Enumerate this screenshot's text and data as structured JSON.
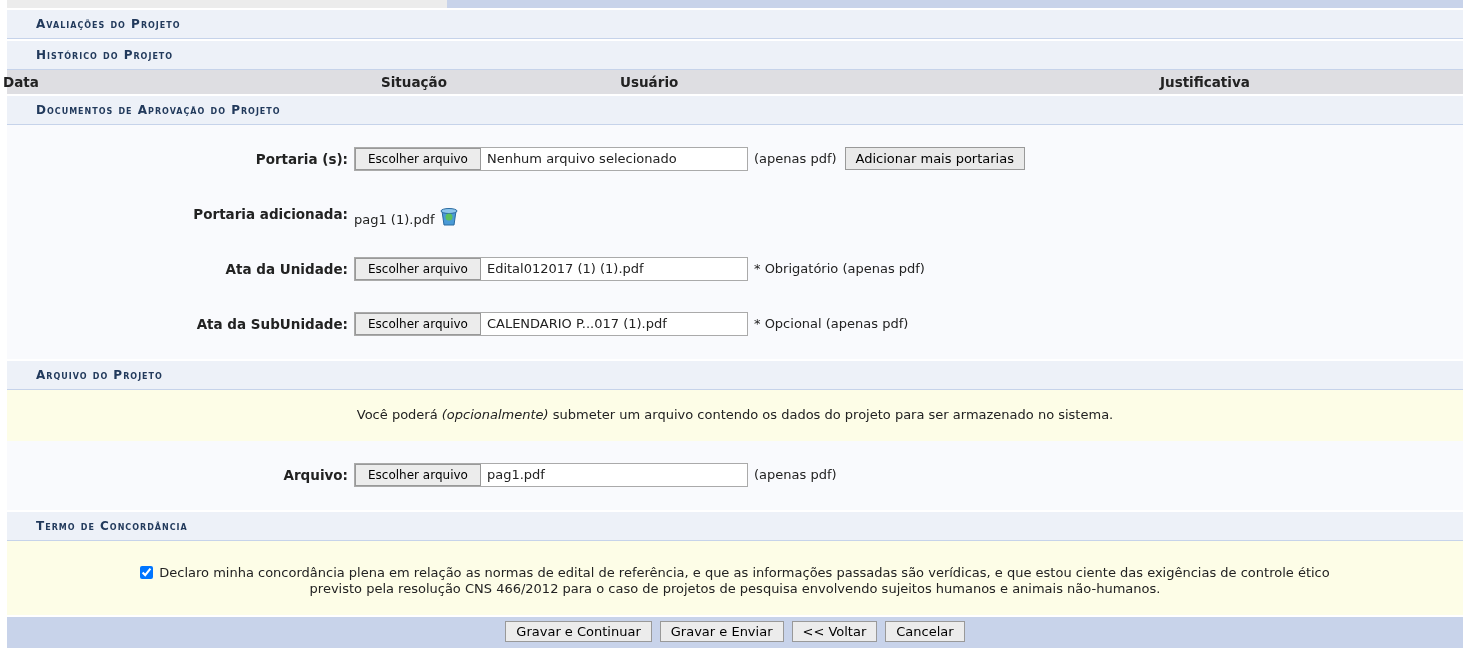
{
  "sections": [
    {
      "title": "Avaliações do Projeto"
    },
    {
      "title": "Histórico do Projeto",
      "columns": [
        "Data",
        "Situação",
        "Usuário",
        "Justificativa"
      ]
    },
    {
      "title": "Documentos de Aprovação do Projeto",
      "fields": [
        {
          "kind": "file",
          "label": "Portaria (s):",
          "button": "Escolher arquivo",
          "value": "Nenhum arquivo selecionado",
          "note": "(apenas pdf)",
          "action": "Adicionar mais portarias"
        },
        {
          "kind": "attached",
          "label": "Portaria adicionada:",
          "value": "pag1 (1).pdf"
        },
        {
          "kind": "file",
          "label": "Ata da Unidade:",
          "button": "Escolher arquivo",
          "value": "Edital012017 (1) (1).pdf",
          "note": "* Obrigatório (apenas pdf)"
        },
        {
          "kind": "file",
          "label": "Ata da SubUnidade:",
          "button": "Escolher arquivo",
          "value": "CALENDARIO P...017 (1).pdf",
          "note": "* Opcional (apenas pdf)"
        }
      ]
    },
    {
      "title": "Arquivo do Projeto",
      "notice": "Você poderá *(opcionalmente)* submeter um arquivo contendo os dados do projeto para ser armazenado no sistema.",
      "fields": [
        {
          "kind": "file",
          "label": "Arquivo:",
          "button": "Escolher arquivo",
          "value": "pag1.pdf",
          "note": "(apenas pdf)"
        }
      ]
    },
    {
      "title": "Termo de Concordância",
      "agreement": {
        "checked": true,
        "text": "Declaro minha concordância plena em relação as normas de edital de referência, e que as informações passadas são verídicas, e que estou ciente das exigências de controle ético previsto pela resolução CNS 466/2012 para o caso de projetos de pesquisa envolvendo sujeitos humanos e animais não-humanos."
      }
    }
  ],
  "buttons": [
    "Gravar e Continuar",
    "Gravar e Enviar",
    "<< Voltar",
    "Cancelar"
  ]
}
